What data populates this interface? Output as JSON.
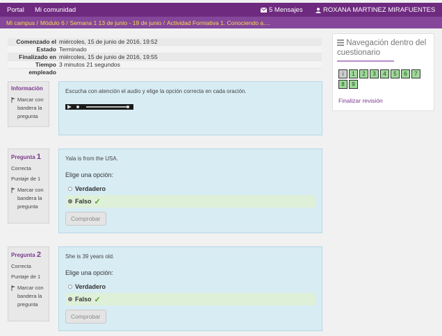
{
  "topbar": {
    "portal": "Portal",
    "community": "Mi comunidad",
    "messages": "5 Mensajes",
    "user": "ROXANA MARTINEZ MIRAFUENTES"
  },
  "breadcrumb": [
    "Mi campus /",
    "Módulo 6 /",
    "Semana 1 13 de junio - 19 de junio /",
    "Actividad Formativa 1. Conociendo a...."
  ],
  "summary": [
    {
      "label": "Comenzado el",
      "value": "miércoles, 15 de junio de 2016, 19:52"
    },
    {
      "label": "Estado",
      "value": "Terminado"
    },
    {
      "label": "Finalizado en",
      "value": "miércoles, 15 de junio de 2016, 19:55"
    },
    {
      "label": "Tiempo empleado",
      "value": "3 minutos 21 segundos"
    }
  ],
  "info_block": {
    "title": "Información",
    "flag": "Marcar con bandera la pregunta",
    "text": "Escucha con atención el audio y elige la opción correcta en cada oración."
  },
  "questions": [
    {
      "label": "Pregunta",
      "number": "1",
      "status": "Correcta",
      "score": "Puntaje de 1",
      "flag": "Marcar con bandera la pregunta",
      "prompt": "Yala is from the USA.",
      "choose": "Elige una opción:",
      "options": [
        "Verdadero",
        "Falso"
      ],
      "check_button": "Comprobar"
    },
    {
      "label": "Pregunta",
      "number": "2",
      "status": "Correcta",
      "score": "Puntaje de 1",
      "flag": "Marcar con bandera la pregunta",
      "prompt": "She is 39 years old.",
      "choose": "Elige una opción:",
      "options": [
        "Verdadero",
        "Falso"
      ],
      "check_button": "Comprobar"
    }
  ],
  "navigation": {
    "title": "Navegación dentro del cuestionario",
    "buttons": [
      "i",
      "1",
      "2",
      "3",
      "4",
      "5",
      "6",
      "7",
      "8",
      "9"
    ],
    "finish": "Finalizar revisión"
  },
  "colors": {
    "topbar": "#6e2a7f",
    "breadcrumb_bar": "#84479a",
    "breadcrumb_text": "#ffd84d",
    "content_bg": "#d8ecf4",
    "correct_bg": "#dff0d8"
  }
}
